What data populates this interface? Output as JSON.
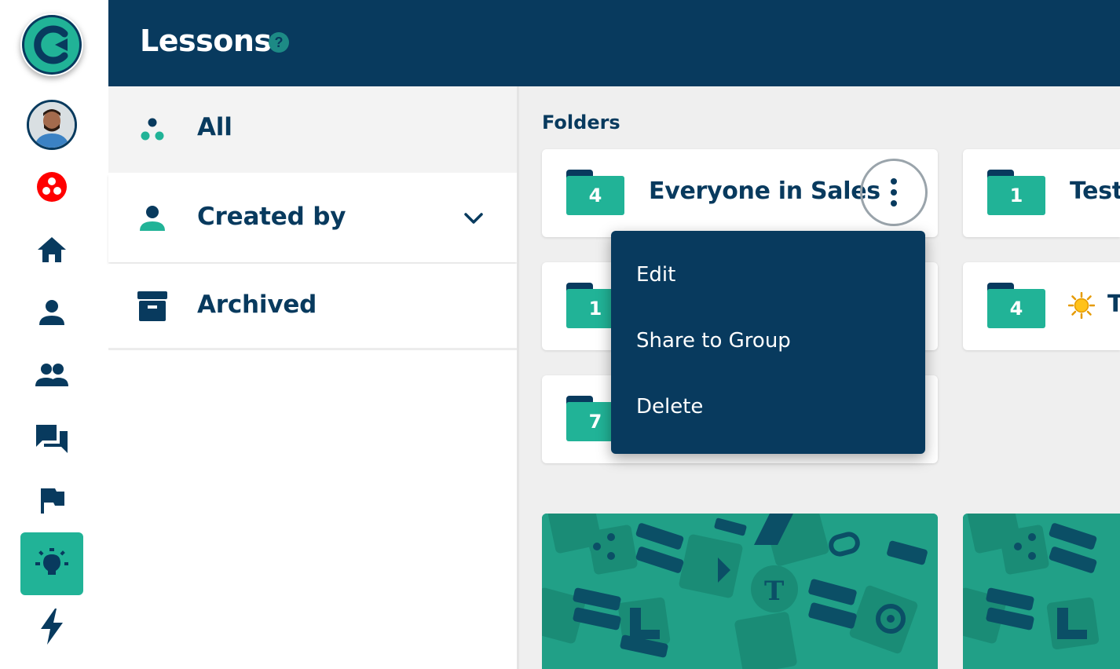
{
  "header": {
    "title": "Lessons",
    "help_icon": "?"
  },
  "rail": {
    "items": [
      {
        "name": "home-icon"
      },
      {
        "name": "person-icon"
      },
      {
        "name": "group-icon"
      },
      {
        "name": "chat-icon"
      },
      {
        "name": "flag-icon"
      },
      {
        "name": "lightbulb-icon",
        "active": true
      },
      {
        "name": "bolt-icon"
      }
    ]
  },
  "filters": {
    "all_label": "All",
    "created_by_label": "Created by",
    "archived_label": "Archived"
  },
  "main": {
    "folders_heading": "Folders",
    "folders": [
      {
        "count": "4",
        "name": "Everyone in Sales"
      },
      {
        "count": "1",
        "name": "Test"
      },
      {
        "count": "1",
        "name": ""
      },
      {
        "count": "4",
        "name": "T"
      },
      {
        "count": "7",
        "name": ""
      }
    ]
  },
  "context_menu": {
    "items": [
      "Edit",
      "Share to Group",
      "Delete"
    ]
  },
  "colors": {
    "navy": "#083a5e",
    "teal": "#21b397",
    "teal_dark": "#1d8a85",
    "background": "#efefef",
    "notification_red": "#ff0000"
  }
}
